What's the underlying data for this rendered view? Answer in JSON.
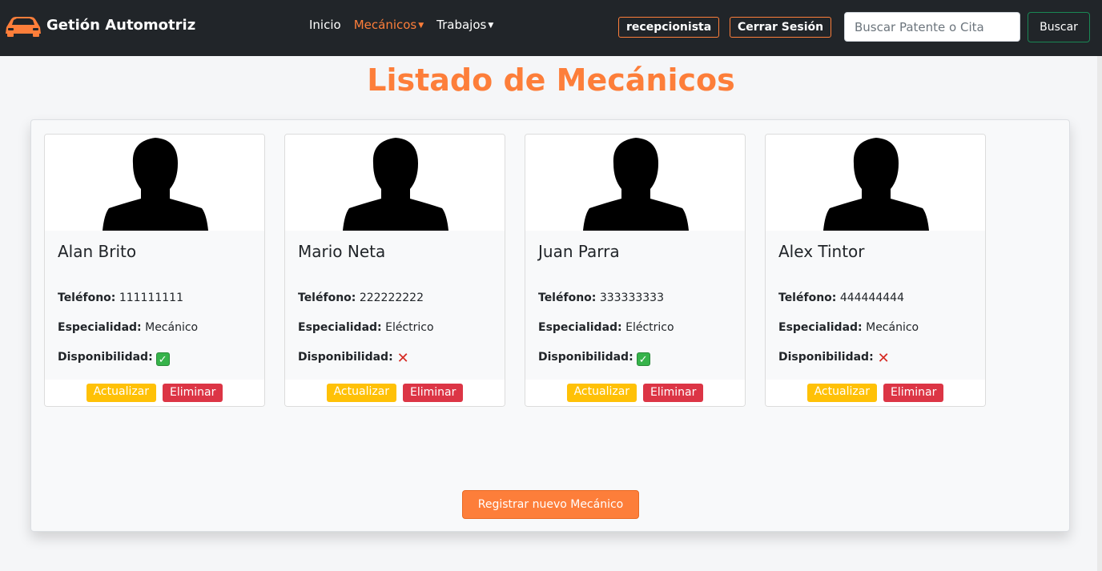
{
  "navbar": {
    "brand": "Getión Automotriz",
    "links": [
      {
        "label": "Inicio",
        "active": false,
        "dropdown": false
      },
      {
        "label": "Mecánicos",
        "active": true,
        "dropdown": true
      },
      {
        "label": "Trabajos",
        "active": false,
        "dropdown": true
      }
    ],
    "role": "recepcionista",
    "logout": "Cerrar Sesión",
    "search_placeholder": "Buscar Patente o Cita",
    "search_button": "Buscar"
  },
  "page": {
    "title": "Listado de Mecánicos"
  },
  "labels": {
    "phone": "Teléfono:",
    "specialty": "Especialidad:",
    "availability": "Disponibilidad:",
    "update": "Actualizar",
    "delete": "Eliminar",
    "register": "Registrar nuevo Mecánico"
  },
  "mechanics": [
    {
      "name": "Alan Brito",
      "phone": "111111111",
      "specialty": "Mecánico",
      "available": true
    },
    {
      "name": "Mario Neta",
      "phone": "222222222",
      "specialty": "Eléctrico",
      "available": false
    },
    {
      "name": "Juan Parra",
      "phone": "333333333",
      "specialty": "Eléctrico",
      "available": true
    },
    {
      "name": "Alex Tintor",
      "phone": "444444444",
      "specialty": "Mecánico",
      "available": false
    }
  ],
  "icons": {
    "brand": "car-icon",
    "avatar": "person-silhouette-icon",
    "available": "check-icon",
    "unavailable": "cross-icon"
  },
  "colors": {
    "accent": "#fd7e3a",
    "navbar": "#212529",
    "update": "#ffc107",
    "delete": "#dc3545"
  }
}
